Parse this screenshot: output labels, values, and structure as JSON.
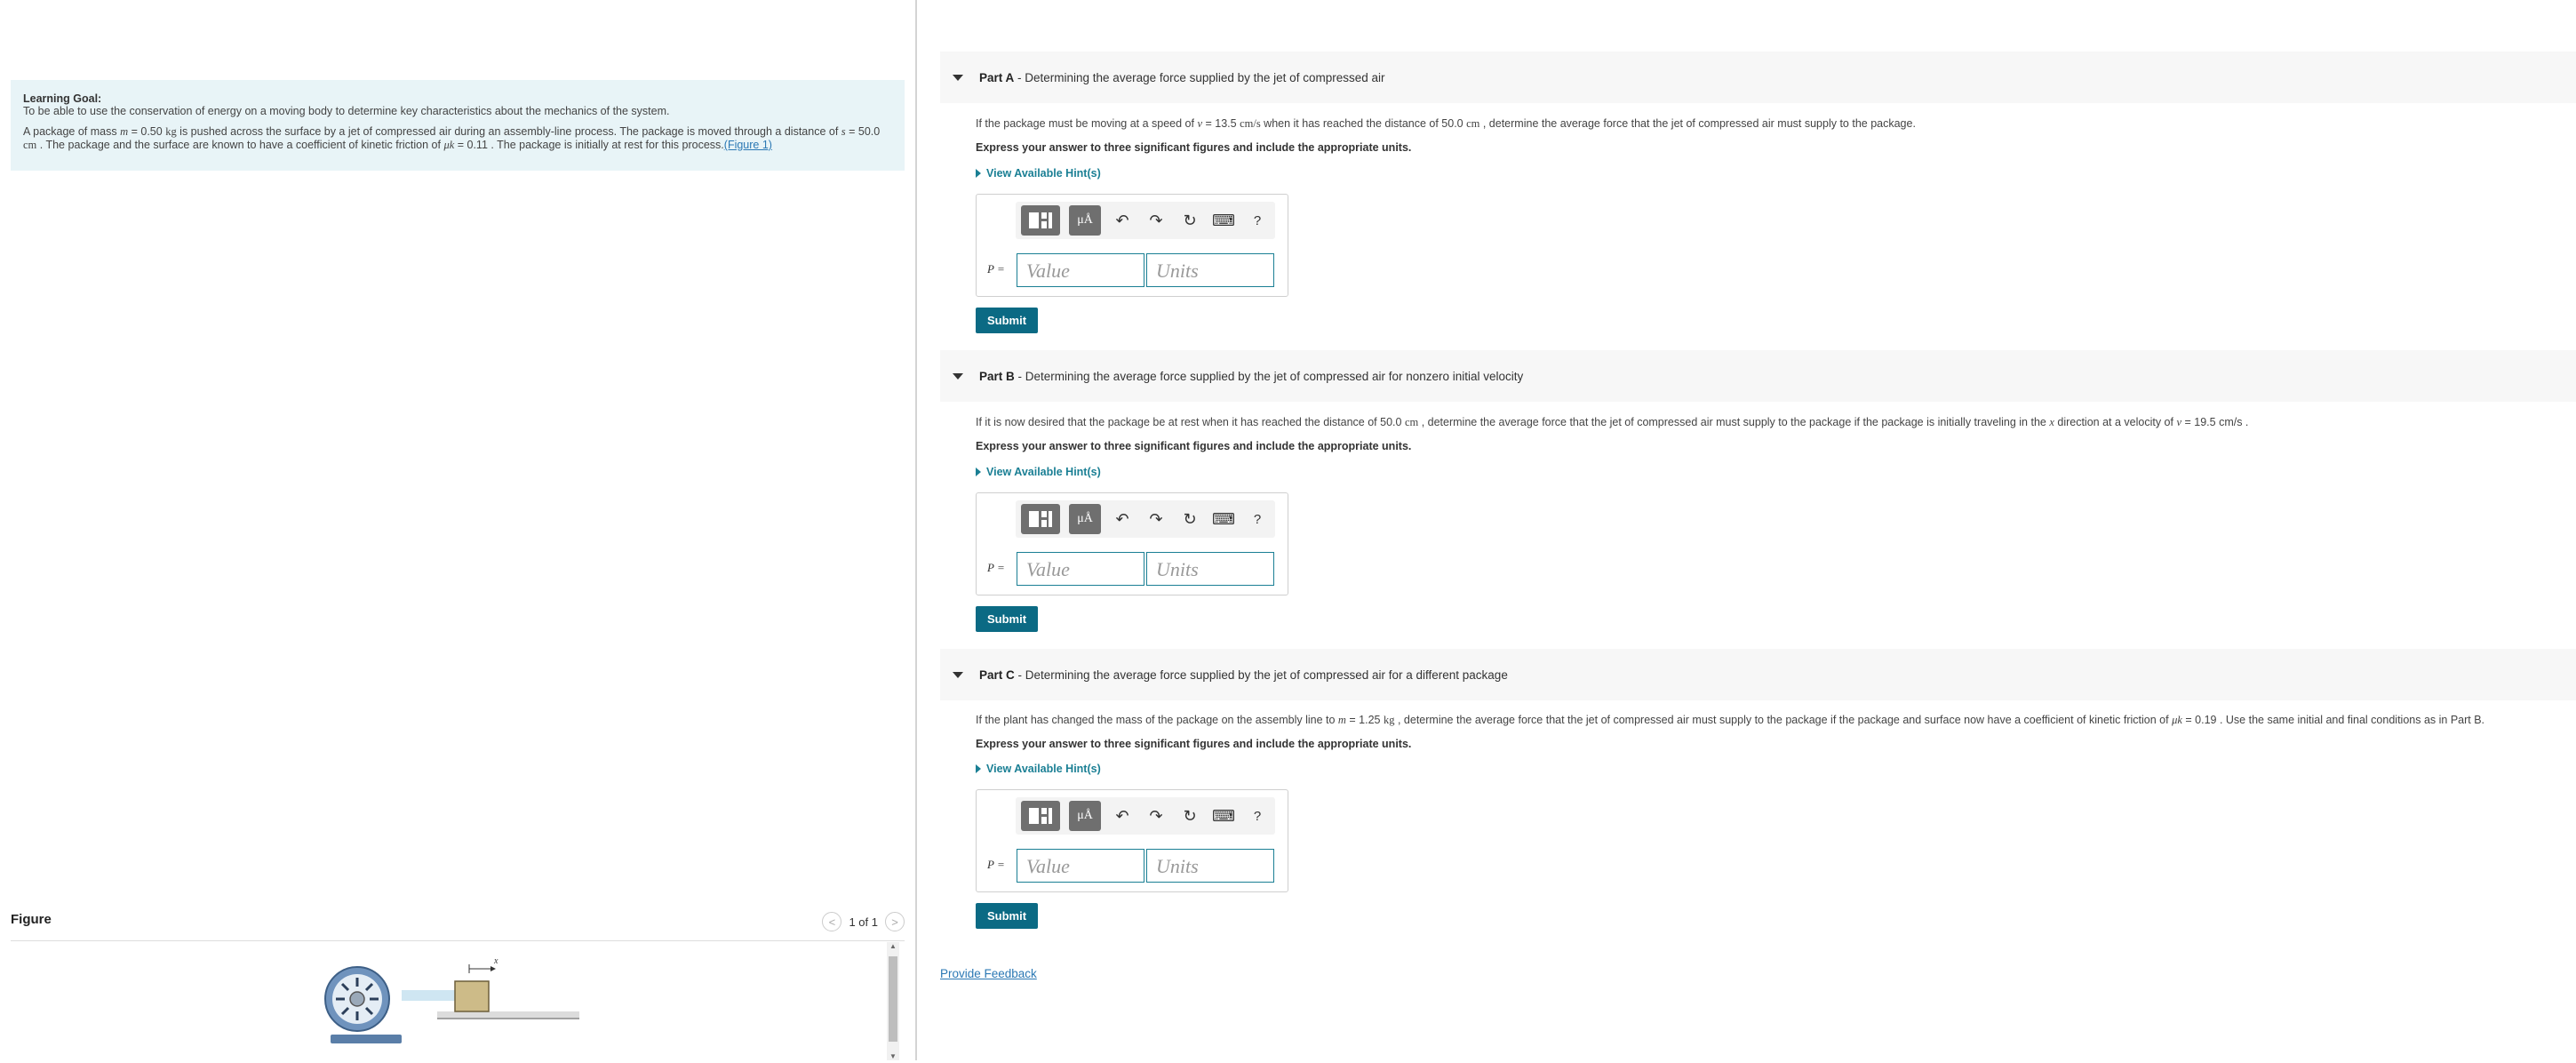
{
  "learning_goal": {
    "title": "Learning Goal:",
    "intro": "To be able to use the conservation of energy on a moving body to determine key characteristics about the mechanics of the system.",
    "p_pre_m": "A package of mass ",
    "p_m_var": "m",
    "p_m_val": " = 0.50 ",
    "p_m_unit": "kg",
    "p_mid": " is pushed across the surface by a jet of compressed air during an assembly-line process. The package is moved through a distance of ",
    "p_s_var": "s",
    "p_s_val": " = 50.0 ",
    "p_s_unit": "cm",
    "p_mid2": " . The package and the surface are known to have a coefficient of kinetic friction of ",
    "p_mu_var": "μk",
    "p_mu_val": " = 0.11 . The package is initially at rest for this process.",
    "figure_link": "(Figure 1)"
  },
  "figure": {
    "label": "Figure",
    "pager_text": "1 of 1",
    "prev_icon": "<",
    "next_icon": ">",
    "axis_label": "x"
  },
  "toolbar": {
    "mu_label": "μÅ",
    "undo_glyph": "↶",
    "redo_glyph": "↷",
    "reset_glyph": "↻",
    "keyboard_glyph": "⌨",
    "help_glyph": "?"
  },
  "parts": [
    {
      "title_bold": "Part A",
      "title_rest": " - Determining the average force supplied by the jet of compressed air",
      "q_pre": "If the package must be moving at a speed of ",
      "q_var": "v",
      "q_val": " = 13.5 ",
      "q_unit": "cm/s",
      "q_post": " when it has reached the distance of 50.0 ",
      "q_unit2": "cm",
      "q_end": " , determine the average force that the jet of compressed air must supply to the package.",
      "express": "Express your answer to three significant figures and include the appropriate units.",
      "hint": "View Available Hint(s)",
      "var_label": "P =",
      "value_placeholder": "Value",
      "units_placeholder": "Units",
      "submit": "Submit"
    },
    {
      "title_bold": "Part B",
      "title_rest": " - Determining the average force supplied by the jet of compressed air for nonzero initial velocity",
      "q_pre": "If it is now desired that the package be at rest when it has reached the distance of 50.0 ",
      "q_var": "cm",
      "q_val": " , determine the average force that the jet of compressed air must supply to the package if the package is initially traveling in the ",
      "q_unit": "x",
      "q_post": " direction at a velocity of ",
      "q_unit2": "v",
      "q_end": " = 19.5 cm/s .",
      "express": "Express your answer to three significant figures and include the appropriate units.",
      "hint": "View Available Hint(s)",
      "var_label": "P =",
      "value_placeholder": "Value",
      "units_placeholder": "Units",
      "submit": "Submit"
    },
    {
      "title_bold": "Part C",
      "title_rest": " - Determining the average force supplied by the jet of compressed air for a different package",
      "q_pre": "If the plant has changed the mass of the package on the assembly line to ",
      "q_var": "m",
      "q_val": " = 1.25 ",
      "q_unit": "kg",
      "q_post": " , determine the average force that the jet of compressed air must supply to the package if the package and surface now have a coefficient of kinetic friction of ",
      "q_unit2": "μk",
      "q_end": " = 0.19 . Use the same initial and final conditions as in Part B.",
      "express": "Express your answer to three significant figures and include the appropriate units.",
      "hint": "View Available Hint(s)",
      "var_label": "P =",
      "value_placeholder": "Value",
      "units_placeholder": "Units",
      "submit": "Submit"
    }
  ],
  "feedback": "Provide Feedback"
}
